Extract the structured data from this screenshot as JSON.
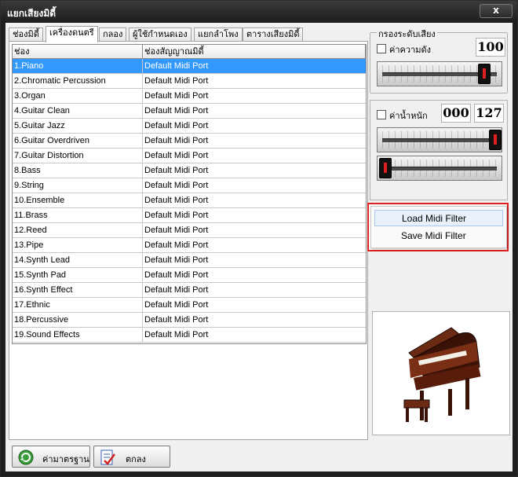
{
  "window": {
    "title": "แยกเสียงมิดี้",
    "close_label": "x"
  },
  "tabs": [
    {
      "label": "ช่องมิดี้"
    },
    {
      "label": "เครื่องดนตรี"
    },
    {
      "label": "กลอง"
    },
    {
      "label": "ผู้ใช้กำหนดเอง"
    },
    {
      "label": "แยกลำโพง"
    },
    {
      "label": "ตารางเสียงมิดี้"
    }
  ],
  "grid": {
    "headers": [
      "ช่อง",
      "ช่องสัญญาณมิดี้"
    ],
    "rows": [
      [
        "1.Piano",
        "Default Midi Port"
      ],
      [
        "2.Chromatic Percussion",
        "Default Midi Port"
      ],
      [
        "3.Organ",
        "Default Midi Port"
      ],
      [
        "4.Guitar Clean",
        "Default Midi Port"
      ],
      [
        "5.Guitar Jazz",
        "Default Midi Port"
      ],
      [
        "6.Guitar Overdriven",
        "Default Midi Port"
      ],
      [
        "7.Guitar Distortion",
        "Default Midi Port"
      ],
      [
        "8.Bass",
        "Default Midi Port"
      ],
      [
        "9.String",
        "Default Midi Port"
      ],
      [
        "10.Ensemble",
        "Default Midi Port"
      ],
      [
        "11.Brass",
        "Default Midi Port"
      ],
      [
        "12.Reed",
        "Default Midi Port"
      ],
      [
        "13.Pipe",
        "Default Midi Port"
      ],
      [
        "14.Synth Lead",
        "Default Midi Port"
      ],
      [
        "15.Synth Pad",
        "Default Midi Port"
      ],
      [
        "16.Synth Effect",
        "Default Midi Port"
      ],
      [
        "17.Ethnic",
        "Default Midi Port"
      ],
      [
        "18.Percussive",
        "Default Midi Port"
      ],
      [
        "19.Sound Effects",
        "Default Midi Port"
      ]
    ],
    "selected_row": 0
  },
  "filter": {
    "group_label": "กรองระดับเสียง",
    "loudness_label": "ค่าความดัง",
    "loudness_value": "100",
    "loudness_level": 0.9,
    "weight_label": "ค่าน้ำหนัก",
    "weight_min": "000",
    "weight_max": "127",
    "weight_max_level": 1.0,
    "weight_min_level": 0.0
  },
  "context_menu": {
    "items": [
      "Load Midi Filter",
      "Save Midi Filter"
    ],
    "hovered": 0
  },
  "buttons": {
    "default_label": "ค่ามาตรฐาน",
    "ok_label": "ตกลง"
  },
  "colors": {
    "selection": "#3399ff",
    "highlight_border": "#e02020"
  }
}
